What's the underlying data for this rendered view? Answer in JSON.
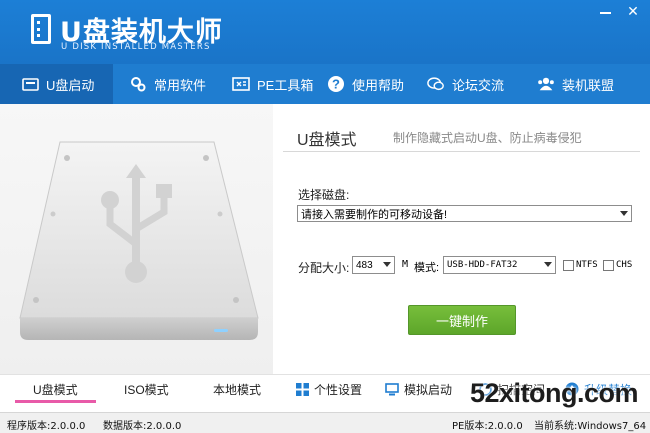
{
  "app": {
    "title": "U盘装机大师",
    "subtitle": "U DISK INSTALLED MASTERS"
  },
  "window_controls": {
    "minimize_icon": "minimize-icon",
    "close_icon": "close-icon",
    "close_glyph": "✕"
  },
  "nav": {
    "items": [
      {
        "label": "U盘启动",
        "icon": "usb-boot-icon",
        "active": true
      },
      {
        "label": "常用软件",
        "icon": "software-icon"
      },
      {
        "label": "PE工具箱",
        "icon": "toolbox-icon"
      },
      {
        "label": "使用帮助",
        "icon": "help-icon"
      },
      {
        "label": "论坛交流",
        "icon": "forum-icon"
      },
      {
        "label": "装机联盟",
        "icon": "alliance-icon"
      }
    ]
  },
  "main": {
    "mode_title": "U盘模式",
    "mode_desc": "制作隐藏式启动U盘、防止病毒侵犯",
    "select_label": "选择磁盘:",
    "device_select_value": "请接入需要制作的可移动设备!",
    "alloc_label": "分配大小:",
    "alloc_value": "483",
    "alloc_unit": "M",
    "mode_label": "模式:",
    "mode_value": "USB-HDD-FAT32",
    "ntfs_label": "NTFS",
    "chs_label": "CHS",
    "make_button": "一键制作"
  },
  "bottom_tabs": {
    "usb_mode": "U盘模式",
    "iso_mode": "ISO模式",
    "local_mode": "本地模式",
    "personalize": "个性设置",
    "simulate": "模拟启动",
    "space": "扫描空间",
    "upgrade": "升级替换"
  },
  "status": {
    "program_version": "程序版本:2.0.0.0",
    "data_version": "数据版本:2.0.0.0",
    "pe_version": "PE版本:2.0.0.0",
    "system": "当前系统:Windows7_64位"
  },
  "watermark": "52xitong.com",
  "colors": {
    "title_bar": "#1c7fd6",
    "nav_active": "#1766b3",
    "make_button": "#6db033",
    "tab_underline": "#e85aa8"
  }
}
